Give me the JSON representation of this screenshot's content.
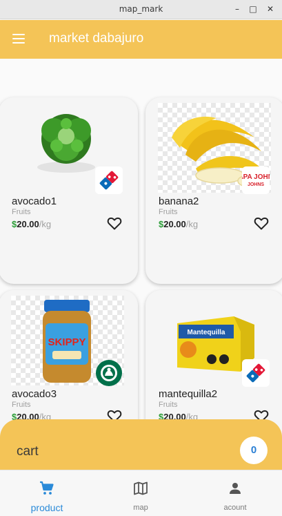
{
  "window": {
    "title": "map_mark",
    "minimize": "–",
    "maximize": "□",
    "close": "✕"
  },
  "appbar": {
    "title": "market dabajuro",
    "menu_icon": "hamburger-menu-icon"
  },
  "products": [
    {
      "name": "avocado1",
      "category": "Fruits",
      "currency": "$",
      "price": "20.00",
      "unit": "/kg",
      "image": "lettuce-image",
      "brand": "dominos-logo",
      "favorite": false
    },
    {
      "name": "banana2",
      "category": "Fruits",
      "currency": "$",
      "price": "20.00",
      "unit": "/kg",
      "image": "banana-image",
      "brand": "papa-johns-logo",
      "brand_text": "PAPA JOHNS",
      "favorite": false
    },
    {
      "name": "avocado3",
      "category": "Fruits",
      "currency": "$",
      "price": "20.00",
      "unit": "/kg",
      "image": "peanut-butter-jar-image",
      "image_text": "SKIPPY",
      "brand": "starbucks-logo",
      "favorite": false
    },
    {
      "name": "mantequilla2",
      "category": "Fruits",
      "currency": "$",
      "price": "20.00",
      "unit": "/kg",
      "image": "butter-package-image",
      "image_text": "Mantequilla",
      "brand": "dominos-logo",
      "favorite": false
    }
  ],
  "cart": {
    "label": "cart",
    "count": "0"
  },
  "bottom_nav": [
    {
      "label": "product",
      "icon": "shopping-cart-icon",
      "active": true
    },
    {
      "label": "map",
      "icon": "map-icon",
      "active": false
    },
    {
      "label": "acount",
      "icon": "person-icon",
      "active": false
    }
  ],
  "colors": {
    "accent": "#f4c457",
    "active_nav": "#2a8ad8",
    "price_currency": "#2e9e3a",
    "cart_count": "#2a7fd4"
  }
}
